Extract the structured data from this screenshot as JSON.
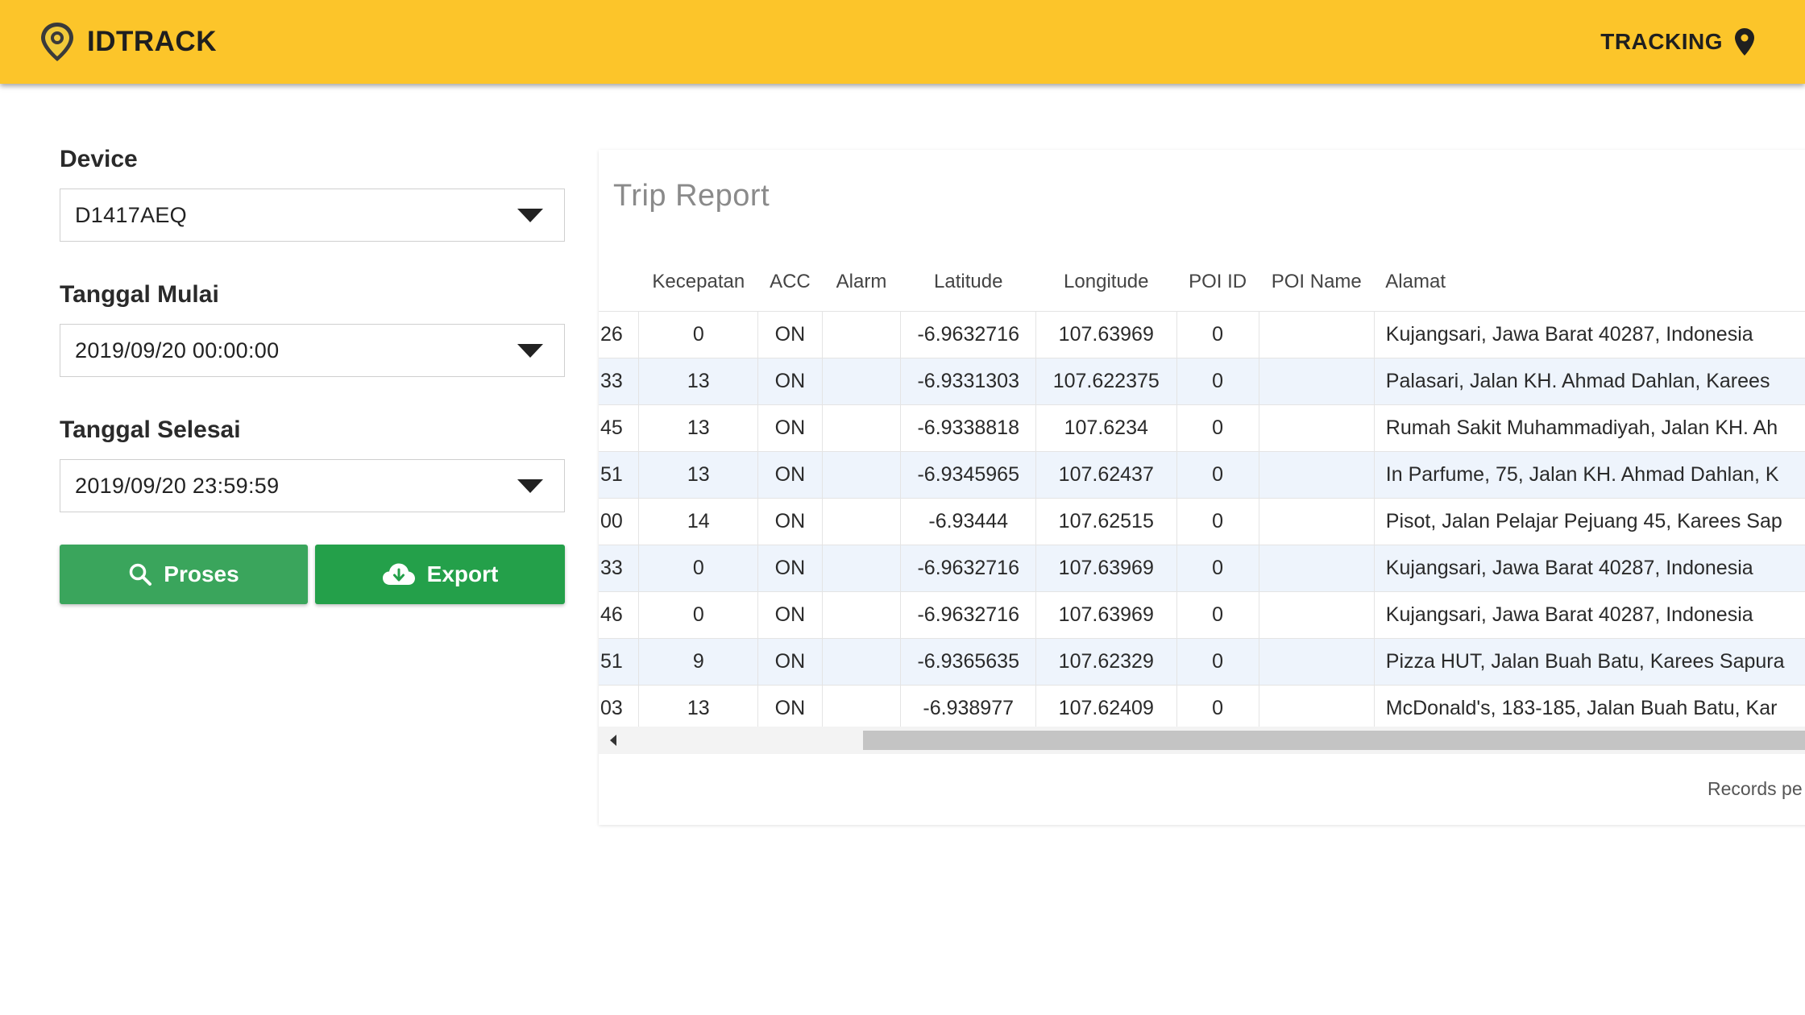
{
  "header": {
    "brand": "IDTRACK",
    "nav_label": "TRACKING",
    "bar_color": "#fcc52a"
  },
  "form": {
    "device": {
      "label": "Device",
      "value": "D1417AEQ"
    },
    "start_date": {
      "label": "Tanggal Mulai",
      "value": "2019/09/20 00:00:00"
    },
    "end_date": {
      "label": "Tanggal Selesai",
      "value": "2019/09/20 23:59:59"
    },
    "proses_label": "Proses",
    "export_label": "Export"
  },
  "report": {
    "title": "Trip Report",
    "columns": [
      "Kecepatan",
      "ACC",
      "Alarm",
      "Latitude",
      "Longitude",
      "POI ID",
      "POI Name",
      "Alamat"
    ],
    "rows": [
      [
        "26",
        "0",
        "ON",
        "",
        "-6.9632716",
        "107.63969",
        "0",
        "",
        "Kujangsari, Jawa Barat 40287, Indonesia"
      ],
      [
        "33",
        "13",
        "ON",
        "",
        "-6.9331303",
        "107.622375",
        "0",
        "",
        "Palasari, Jalan KH. Ahmad Dahlan, Karees"
      ],
      [
        "45",
        "13",
        "ON",
        "",
        "-6.9338818",
        "107.6234",
        "0",
        "",
        "Rumah Sakit Muhammadiyah, Jalan KH. Ah"
      ],
      [
        "51",
        "13",
        "ON",
        "",
        "-6.9345965",
        "107.62437",
        "0",
        "",
        "In Parfume, 75, Jalan KH. Ahmad Dahlan, K"
      ],
      [
        "00",
        "14",
        "ON",
        "",
        "-6.93444",
        "107.62515",
        "0",
        "",
        "Pisot, Jalan Pelajar Pejuang 45, Karees Sap"
      ],
      [
        "33",
        "0",
        "ON",
        "",
        "-6.9632716",
        "107.63969",
        "0",
        "",
        "Kujangsari, Jawa Barat 40287, Indonesia"
      ],
      [
        "46",
        "0",
        "ON",
        "",
        "-6.9632716",
        "107.63969",
        "0",
        "",
        "Kujangsari, Jawa Barat 40287, Indonesia"
      ],
      [
        "51",
        "9",
        "ON",
        "",
        "-6.9365635",
        "107.62329",
        "0",
        "",
        "Pizza HUT, Jalan Buah Batu, Karees Sapura"
      ],
      [
        "03",
        "13",
        "ON",
        "",
        "-6.938977",
        "107.62409",
        "0",
        "",
        "McDonald's, 183-185, Jalan Buah Batu, Kar"
      ]
    ],
    "records_text": "Records pe"
  }
}
